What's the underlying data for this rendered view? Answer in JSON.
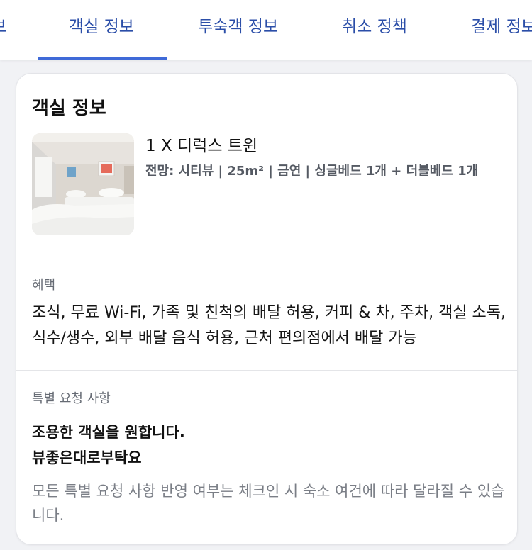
{
  "tabs": [
    {
      "label": "보"
    },
    {
      "label": "객실 정보"
    },
    {
      "label": "투숙객 정보"
    },
    {
      "label": "취소 정책"
    },
    {
      "label": "결제 정보"
    }
  ],
  "active_tab": "객실 정보",
  "card": {
    "title": "객실 정보",
    "room": {
      "name": "1 X 디럭스 트윈",
      "detail": "전망: 시티뷰 | 25m² | 금연 | 싱글베드 1개 + 더블베드 1개"
    },
    "benefits": {
      "label": "혜택",
      "text": "조식, 무료 Wi-Fi, 가족 및 친척의 배달 허용, 커피 & 차, 주차, 객실 소독, 식수/생수, 외부 배달 음식 허용, 근처 편의점에서 배달 가능"
    },
    "special_requests": {
      "label": "특별 요청 사항",
      "lines": [
        "조용한 객실을 원합니다.",
        "뷰좋은대로부탁요"
      ],
      "notice": "모든 특별 요청 사항 반영 여부는 체크인 시 숙소 여건에 따라 달라질 수 있습니다."
    }
  },
  "colors": {
    "tab_text": "#2b4ea8",
    "tab_underline": "#3f6ad8",
    "page_bg": "#f1f2f5"
  }
}
